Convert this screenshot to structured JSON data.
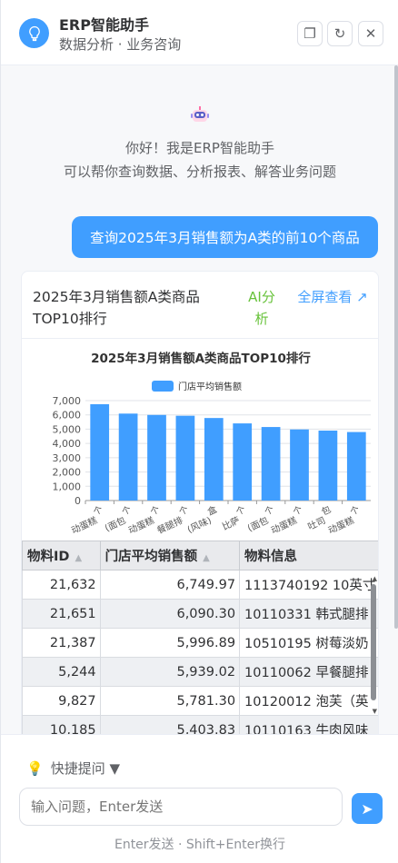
{
  "header": {
    "title": "ERP智能助手",
    "subtitle": "数据分析 · 业务咨询",
    "restore_icon": "window-restore-icon",
    "refresh_icon": "refresh-icon",
    "close_icon": "close-icon"
  },
  "welcome": {
    "line1": "你好！我是ERP智能助手",
    "line2": "可以帮你查询数据、分析报表、解答业务问题"
  },
  "user_message": "查询2025年3月销售额为A类的前10个商品",
  "result_card": {
    "title": "2025年3月销售额A类商品TOP10排行",
    "ai_label": "AI分析",
    "fullscreen_label": "全屏查看 ↗"
  },
  "chart_data": {
    "type": "bar",
    "title": "2025年3月销售额A类商品TOP10排行",
    "series": [
      {
        "name": "门店平均销售额",
        "values": [
          6749.97,
          6090.3,
          5996.89,
          5939.02,
          5781.3,
          5403.83,
          5150,
          4980,
          4900,
          4800
        ]
      }
    ],
    "categories": [
      "...个",
      "...面包",
      "...个",
      "...腿排",
      "...盒",
      "...面包",
      "...个",
      "...吐司",
      "...包",
      "...个"
    ],
    "category_labels": [
      "个",
      "个",
      "个",
      "个",
      "盒",
      "个",
      "个",
      "个",
      "包",
      "个"
    ],
    "category_sublabels": [
      "动蛋糕",
      "(面包",
      "动蛋糕",
      "餐腿排",
      "(风味)",
      "比萨",
      "(面包",
      "动蛋糕",
      "吐司",
      "动蛋糕"
    ],
    "yticks": [
      0,
      1000,
      2000,
      3000,
      4000,
      5000,
      6000,
      7000
    ],
    "ytick_labels": [
      "0",
      "1,000",
      "2,000",
      "3,000",
      "4,000",
      "5,000",
      "6,000",
      "7,000"
    ],
    "ylim": [
      0,
      7000
    ],
    "legend": "top-center",
    "grid": true,
    "color": "#409eff"
  },
  "table": {
    "columns": [
      "物料ID",
      "门店平均销售额",
      "物料信息"
    ],
    "rows": [
      [
        "21,632",
        "6,749.97",
        "1113740192 10英寸"
      ],
      [
        "21,651",
        "6,090.30",
        "10110331 韩式腿排"
      ],
      [
        "21,387",
        "5,996.89",
        "10510195 树莓淡奶"
      ],
      [
        "5,244",
        "5,939.02",
        "10110062 早餐腿排"
      ],
      [
        "9,827",
        "5,781.30",
        "10120012 泡芙（英"
      ],
      [
        "10,185",
        "5,403.83",
        "10110163 牛肉风味"
      ]
    ]
  },
  "footer": {
    "quick_label": "快捷提问 ▼",
    "input_placeholder": "输入问题，Enter发送",
    "send_icon": "send-icon",
    "hint": "Enter发送 · Shift+Enter换行"
  },
  "colors": {
    "primary": "#409eff",
    "ai": "#67c23a"
  }
}
